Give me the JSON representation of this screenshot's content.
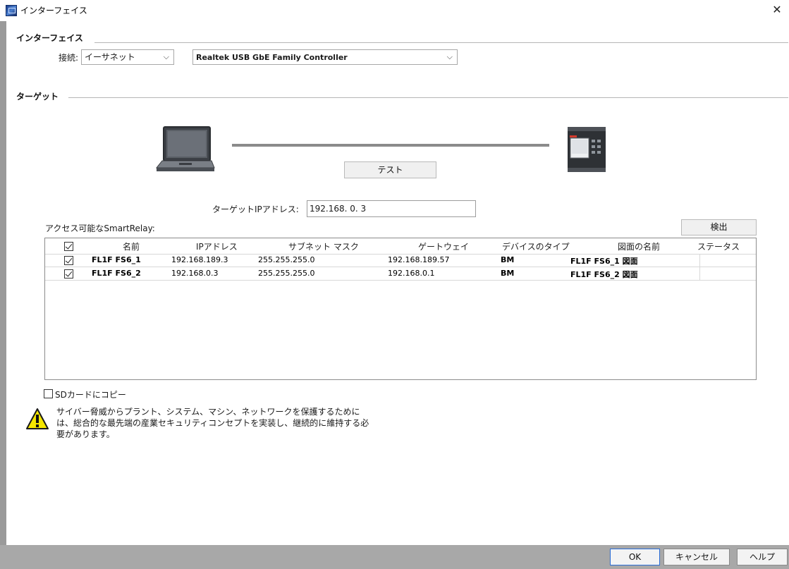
{
  "window": {
    "title": "インターフェイス",
    "close_label": "✕"
  },
  "interface_section": {
    "heading": "インターフェイス",
    "connection_label": "接続:",
    "connection_value": "イーサネット",
    "adapter_value": "Realtek USB GbE Family Controller"
  },
  "target_section": {
    "heading": "ターゲット",
    "test_button": "テスト",
    "target_ip_label": "ターゲットIPアドレス:",
    "target_ip_value": "192.168.  0.  3"
  },
  "accessible": {
    "label": "アクセス可能なSmartRelay:",
    "detect_button": "検出"
  },
  "table": {
    "headers": [
      "名前",
      "IPアドレス",
      "サブネット マスク",
      "ゲートウェイ",
      "デバイスのタイプ",
      "図面の名前",
      "ステータス"
    ],
    "rows": [
      {
        "checked": true,
        "name": "FL1F FS6_1",
        "ip": "192.168.189.3",
        "mask": "255.255.255.0",
        "gateway": "192.168.189.57",
        "type": "BM",
        "drawing": "FL1F FS6_1 図面",
        "status": ""
      },
      {
        "checked": true,
        "name": "FL1F FS6_2",
        "ip": "192.168.0.3",
        "mask": "255.255.255.0",
        "gateway": "192.168.0.1",
        "type": "BM",
        "drawing": "FL1F FS6_2 図面",
        "status": ""
      }
    ]
  },
  "sd_copy": {
    "label": "SDカードにコピー",
    "checked": false
  },
  "warning": {
    "line1": "サイバー脅威からプラント、システム、マシン、ネットワークを保護するために",
    "line2": "は、総合的な最先端の産業セキュリティコンセプトを実装し、継続的に維持する必",
    "line3": "要があります。"
  },
  "footer": {
    "ok": "OK",
    "cancel": "キャンセル",
    "help": "ヘルプ"
  },
  "icons": {
    "laptop": "laptop-icon",
    "device": "plc-device-icon",
    "warning": "warning-icon",
    "app": "app-icon"
  }
}
